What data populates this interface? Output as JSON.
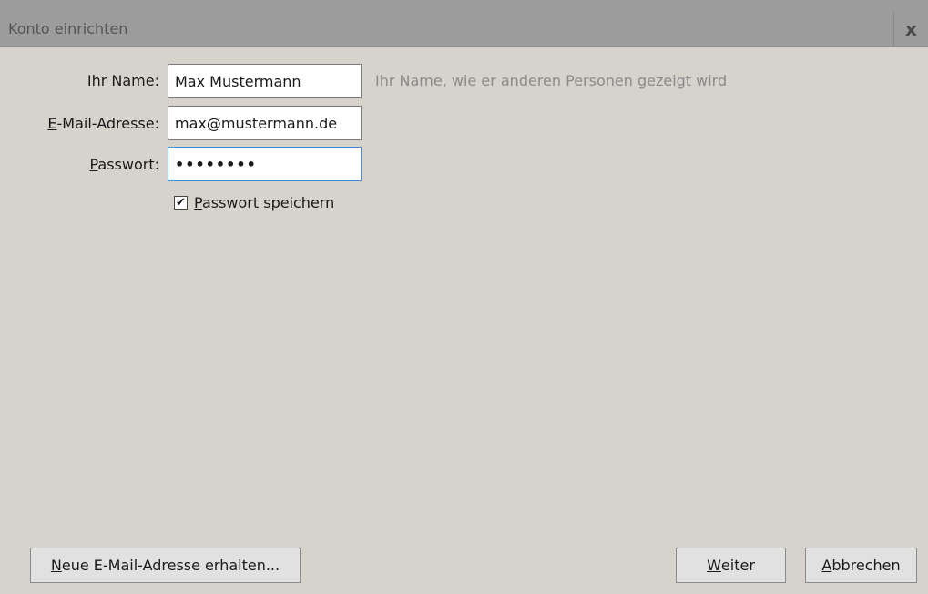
{
  "window": {
    "title": "Konto einrichten",
    "close_glyph": "x"
  },
  "form": {
    "name": {
      "label_prefix": "Ihr ",
      "label_accesskey": "N",
      "label_suffix": "ame:",
      "value": "Max Mustermann",
      "hint": "Ihr Name, wie er anderen Personen gezeigt wird"
    },
    "email": {
      "label_accesskey": "E",
      "label_suffix": "-Mail-Adresse:",
      "value": "max@mustermann.de"
    },
    "password": {
      "label_accesskey": "P",
      "label_suffix": "asswort:",
      "value": "••••••••"
    },
    "remember": {
      "checked": true,
      "check_glyph": "✔",
      "label_accesskey": "P",
      "label_suffix": "asswort speichern"
    }
  },
  "buttons": {
    "new_address": {
      "accesskey": "N",
      "label_suffix": "eue E-Mail-Adresse erhalten..."
    },
    "next": {
      "accesskey": "W",
      "label_suffix": "eiter"
    },
    "cancel": {
      "accesskey": "A",
      "label_suffix": "bbrechen"
    }
  }
}
